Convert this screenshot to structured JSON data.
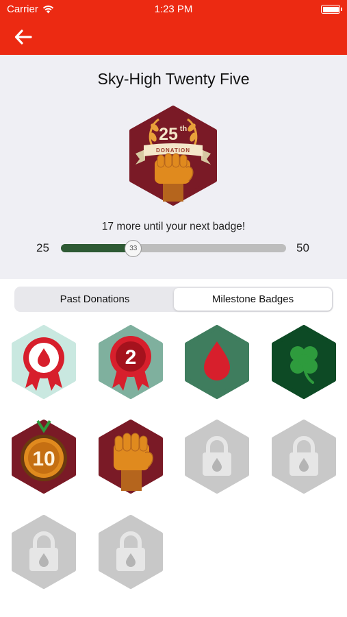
{
  "status_bar": {
    "carrier": "Carrier",
    "time": "1:23 PM"
  },
  "nav": {
    "back_icon": "arrow-left-icon"
  },
  "badge": {
    "title": "Sky-High Twenty Five",
    "hero_number": "25",
    "hero_suffix": "th",
    "hero_ribbon": "DONATION",
    "next_text": "17 more until your next badge!"
  },
  "progress": {
    "min": "25",
    "max": "50",
    "current": "33",
    "fraction": 0.32
  },
  "tabs": [
    {
      "label": "Past Donations",
      "active": false
    },
    {
      "label": "Milestone Badges",
      "active": true
    }
  ],
  "colors": {
    "brand_red": "#ec2a12",
    "progress_green": "#2e5a34",
    "locked_gray": "#c8c8c8"
  },
  "milestone_badges": [
    {
      "icon": "first-donation-ribbon-badge",
      "unlocked": true
    },
    {
      "icon": "second-donation-ribbon-badge",
      "unlocked": true,
      "number": "2"
    },
    {
      "icon": "blood-drop-badge",
      "unlocked": true
    },
    {
      "icon": "four-leaf-clover-badge",
      "unlocked": true
    },
    {
      "icon": "ten-medal-badge",
      "unlocked": true,
      "number": "10"
    },
    {
      "icon": "raised-fist-badge",
      "unlocked": true
    },
    {
      "icon": "locked-badge",
      "unlocked": false
    },
    {
      "icon": "locked-badge",
      "unlocked": false
    },
    {
      "icon": "locked-badge",
      "unlocked": false
    },
    {
      "icon": "locked-badge",
      "unlocked": false
    }
  ]
}
